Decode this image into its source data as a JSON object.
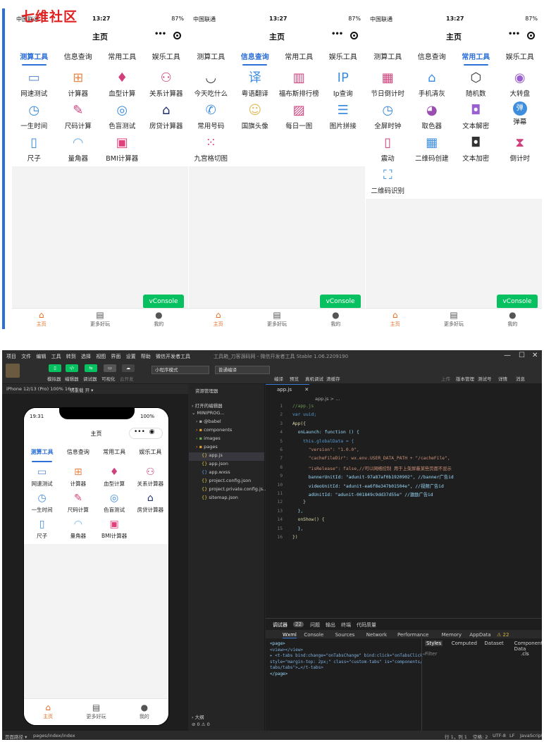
{
  "watermark": "七维社区",
  "phones": [
    {
      "status": {
        "carrier": "中国联通",
        "time": "13:27",
        "battery": "87%"
      },
      "title": "主页",
      "tabs": [
        "测算工具",
        "信息查询",
        "常用工具",
        "娱乐工具"
      ],
      "active_tab": 0,
      "items": [
        {
          "label": "网速测试",
          "icon": "speed-test-icon",
          "glyph": "▭",
          "color": "#5b8ad6"
        },
        {
          "label": "计算器",
          "icon": "calculator-icon",
          "glyph": "⊞",
          "color": "#e8894a"
        },
        {
          "label": "血型计算",
          "icon": "blood-drop-icon",
          "glyph": "♦",
          "color": "#d0407c"
        },
        {
          "label": "关系计算器",
          "icon": "people-icon",
          "glyph": "⚇",
          "color": "#d0407c"
        },
        {
          "label": "一生时间",
          "icon": "clock-icon",
          "glyph": "◷",
          "color": "#3f8ede"
        },
        {
          "label": "尺码计算",
          "icon": "ruler-pencil-icon",
          "glyph": "✎",
          "color": "#d0407c"
        },
        {
          "label": "色盲测试",
          "icon": "target-icon",
          "glyph": "◎",
          "color": "#3f8ede"
        },
        {
          "label": "房贷计算器",
          "icon": "house-icon",
          "glyph": "⌂",
          "color": "#1e2f6e"
        },
        {
          "label": "尺子",
          "icon": "ruler-icon",
          "glyph": "▯",
          "color": "#3f8ede"
        },
        {
          "label": "量角器",
          "icon": "protractor-icon",
          "glyph": "◠",
          "color": "#6fb3e6"
        },
        {
          "label": "BMI计算器",
          "icon": "scale-icon",
          "glyph": "▣",
          "color": "#e0407c"
        }
      ]
    },
    {
      "status": {
        "carrier": "中国联通",
        "time": "13:27",
        "battery": "87%"
      },
      "title": "主页",
      "tabs": [
        "测算工具",
        "信息查询",
        "常用工具",
        "娱乐工具"
      ],
      "active_tab": 1,
      "items": [
        {
          "label": "今天吃什么",
          "icon": "bowl-icon",
          "glyph": "◡",
          "color": "#333"
        },
        {
          "label": "粤语翻译",
          "icon": "translate-icon",
          "glyph": "译",
          "color": "#3f8ede"
        },
        {
          "label": "福布斯排行榜",
          "icon": "buildings-icon",
          "glyph": "▥",
          "color": "#d0407c"
        },
        {
          "label": "Ip查询",
          "icon": "ip-icon",
          "glyph": "IP",
          "color": "#3f8ede"
        },
        {
          "label": "常用号码",
          "icon": "phone-icon",
          "glyph": "✆",
          "color": "#3f8ede"
        },
        {
          "label": "国旗头像",
          "icon": "avatar-icon",
          "glyph": "☺",
          "color": "#e0c060"
        },
        {
          "label": "每日一图",
          "icon": "image-icon",
          "glyph": "▨",
          "color": "#d0407c"
        },
        {
          "label": "图片拼接",
          "icon": "stitch-icon",
          "glyph": "☰",
          "color": "#3f8ede"
        },
        {
          "label": "九宫格切图",
          "icon": "grid-icon",
          "glyph": "⁙",
          "color": "#d0407c"
        }
      ]
    },
    {
      "status": {
        "carrier": "中国联通",
        "time": "13:27",
        "battery": "87%"
      },
      "title": "主页",
      "tabs": [
        "测算工具",
        "信息查询",
        "常用工具",
        "娱乐工具"
      ],
      "active_tab": 2,
      "items": [
        {
          "label": "节日倒计时",
          "icon": "calendar-icon",
          "glyph": "▦",
          "color": "#d0407c"
        },
        {
          "label": "手机清灰",
          "icon": "broom-icon",
          "glyph": "⌂",
          "color": "#3f8ede"
        },
        {
          "label": "随机数",
          "icon": "dice-icon",
          "glyph": "⬡",
          "color": "#333"
        },
        {
          "label": "大转盘",
          "icon": "wheel-icon",
          "glyph": "◉",
          "color": "#9a5fd0"
        },
        {
          "label": "全屏时钟",
          "icon": "clock-icon",
          "glyph": "◷",
          "color": "#3f8ede"
        },
        {
          "label": "取色器",
          "icon": "palette-icon",
          "glyph": "◕",
          "color": "#9a4fb0"
        },
        {
          "label": "文本解密",
          "icon": "unlock-icon",
          "glyph": "◘",
          "color": "#9a5fd0"
        },
        {
          "label": "弹幕",
          "icon": "bullet-icon",
          "glyph": "弹",
          "color": "#fff"
        },
        {
          "label": "震动",
          "icon": "vibrate-icon",
          "glyph": "▯",
          "color": "#d0407c"
        },
        {
          "label": "二维码创建",
          "icon": "qrcode-icon",
          "glyph": "▦",
          "color": "#3f8ede"
        },
        {
          "label": "文本加密",
          "icon": "lock-icon",
          "glyph": "◘",
          "color": "#333"
        },
        {
          "label": "倒计时",
          "icon": "hourglass-icon",
          "glyph": "⧗",
          "color": "#d0407c"
        },
        {
          "label": "二维码识别",
          "icon": "scan-icon",
          "glyph": "⛶",
          "color": "#3f8ede"
        }
      ]
    }
  ],
  "vconsole": "vConsole",
  "tabbar": [
    {
      "label": "主页",
      "icon": "home-icon"
    },
    {
      "label": "更多好玩",
      "icon": "more-icon"
    },
    {
      "label": "我的",
      "icon": "user-icon"
    }
  ],
  "ide": {
    "menus": [
      "项目",
      "文件",
      "编辑",
      "工具",
      "转到",
      "选择",
      "视图",
      "界面",
      "设置",
      "帮助",
      "微信开发者工具"
    ],
    "title": "工具箱_刀客源码网 - 微信开发者工具 Stable 1.06.2209190",
    "toolbar": {
      "left": [
        "模拟器",
        "编辑器",
        "调试器",
        "可视化",
        "云开发"
      ],
      "mode": "小程序模式",
      "compile": "普通编译",
      "mid": [
        "编译",
        "预览",
        "真机调试",
        "清缓存"
      ],
      "right": [
        "上传",
        "版本管理",
        "测试号",
        "详情",
        "消息"
      ]
    },
    "simbar": {
      "device": "iPhone 12/13 (Pro) 100% 16 ▾",
      "hot": "热重载 开 ▾"
    },
    "sim": {
      "time": "19:31",
      "battery": "100%",
      "title": "主页",
      "tabs": [
        "测算工具",
        "信息查询",
        "常用工具",
        "娱乐工具"
      ],
      "items": [
        "网速测试",
        "计算器",
        "血型计算",
        "关系计算器",
        "一生时间",
        "尺码计算",
        "色盲测试",
        "房贷计算器",
        "尺子",
        "量角器",
        "BMI计算器"
      ],
      "tabbar": [
        "主页",
        "更多好玩",
        "我的"
      ]
    },
    "explorer": {
      "title": "资源管理器",
      "open": "打开的编辑器",
      "project": "MINIPROG...",
      "items": [
        "@babel",
        "components",
        "images",
        "pages",
        "app.js",
        "app.json",
        "app.wxss",
        "project.config.json",
        "project.private.config.js...",
        "sitemap.json"
      ],
      "outline": "大纲",
      "problems": "⊘ 0 ⚠ 0"
    },
    "editor": {
      "tab": "app.js",
      "crumb": "app.js > ...",
      "lines": [
        {
          "n": "1",
          "t": "//app.js",
          "c": "cm"
        },
        {
          "n": "2",
          "t": "var uuid;",
          "c": "kw"
        },
        {
          "n": "3",
          "t": "App({",
          "c": "fn"
        },
        {
          "n": "4",
          "t": "  onLaunch: function () {",
          "c": "pr"
        },
        {
          "n": "5",
          "t": "    this.globalData = {",
          "c": "kw"
        },
        {
          "n": "6",
          "t": "      \"version\": \"1.0.0\",",
          "c": "str"
        },
        {
          "n": "7",
          "t": "      \"cacheFileDir\": wx.env.USER_DATA_PATH + \"/cacheFile\",",
          "c": "str"
        },
        {
          "n": "8",
          "t": "      \"isRelease\": false,//可以网络控制 用于上架屏蔽某些页面不显示",
          "c": "str"
        },
        {
          "n": "9",
          "t": "      bannerUnitId: \"adunit-97a87af0b1920902\", //banner广告id",
          "c": "pr"
        },
        {
          "n": "10",
          "t": "      videoUnitId: \"adunit-ea6f8e347b01504e\", //视频广告id",
          "c": "pr"
        },
        {
          "n": "11",
          "t": "      adUnitId: \"adunit-001849c9dd37d55e\" //激励广告id",
          "c": "pr"
        },
        {
          "n": "12",
          "t": "    }",
          "c": "pr"
        },
        {
          "n": "13",
          "t": "  },",
          "c": "pr"
        },
        {
          "n": "14",
          "t": "  onShow() {",
          "c": "fn"
        },
        {
          "n": "15",
          "t": "  },",
          "c": "pr"
        },
        {
          "n": "16",
          "t": "})",
          "c": "fn"
        }
      ]
    },
    "debug": {
      "tabs": [
        "调试器",
        "22",
        "问题",
        "输出",
        "终端",
        "代码质量"
      ],
      "subtabs": [
        "Wxml",
        "Console",
        "Sources",
        "Network",
        "Performance",
        "Memory",
        "AppData"
      ],
      "warn": "⚠ 22",
      "xml": [
        "<page>",
        "  <view></view>",
        "▸ <t-tabs bind:change=\"onTabsChange\" bind:click=\"onTabsClick\"",
        "style=\"margin-top: 2px;\" class=\"custom-tabs\" is=\"components/",
        "tabs/tabs\">…</t-tabs>",
        "</page>"
      ],
      "styles": [
        "Styles",
        "Computed",
        "Dataset",
        "Component Data"
      ],
      "filter": "Filter",
      "cls": ".cls"
    },
    "status": {
      "left": "页面路径 ▾",
      "path": "pages/index/index",
      "pos": "行 1，列 1",
      "space": "空格: 2",
      "enc": "UTF-8",
      "eol": "LF",
      "lang": "JavaScript"
    }
  }
}
